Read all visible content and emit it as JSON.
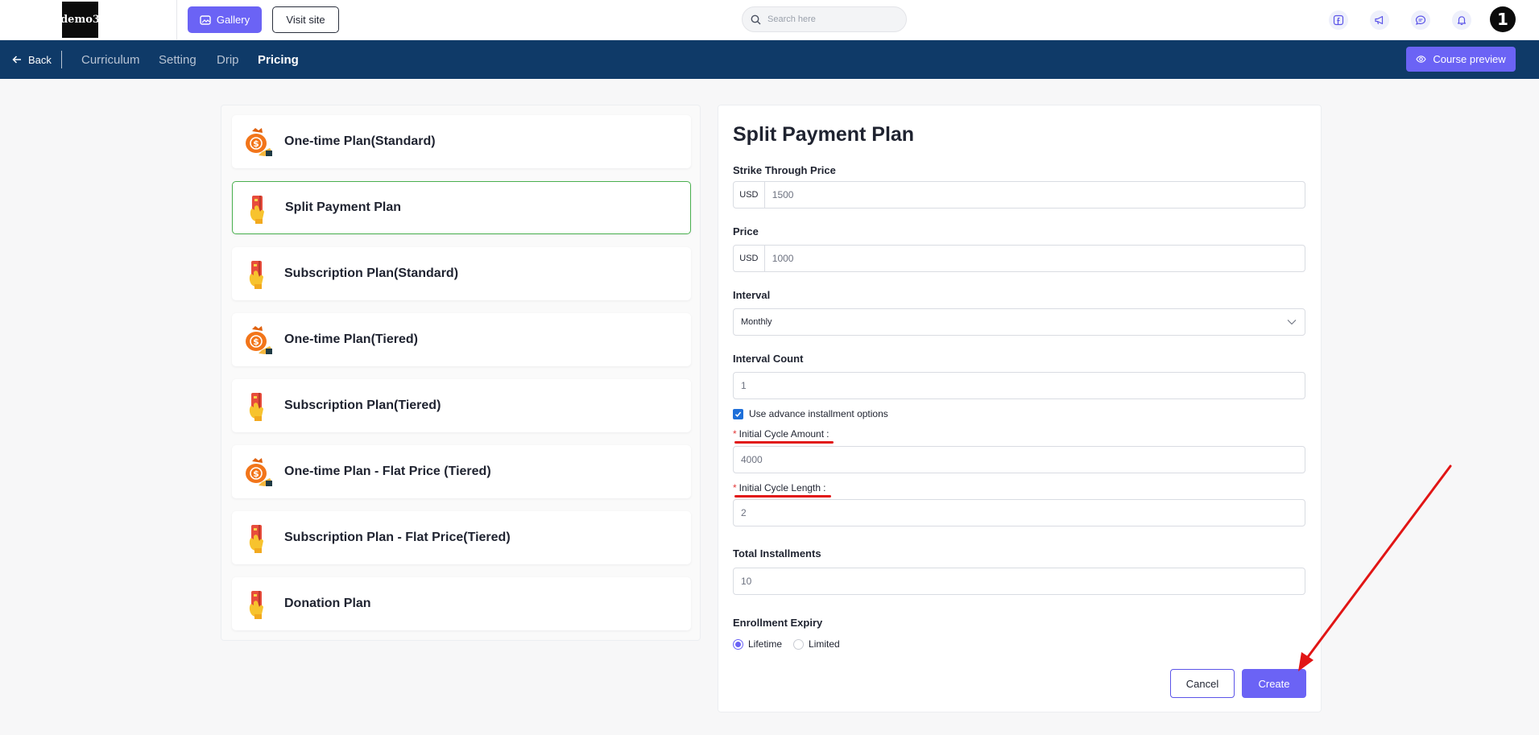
{
  "topbar": {
    "logo_text": "demo3",
    "gallery_label": "Gallery",
    "visit_site_label": "Visit site",
    "search_placeholder": "Search here",
    "avatar_text": "1",
    "icons": [
      "facebook-icon",
      "megaphone-icon",
      "chat-icon",
      "bell-icon"
    ]
  },
  "nav": {
    "back_label": "Back",
    "tabs": [
      {
        "label": "Curriculum",
        "active": false
      },
      {
        "label": "Setting",
        "active": false
      },
      {
        "label": "Drip",
        "active": false
      },
      {
        "label": "Pricing",
        "active": true
      }
    ],
    "course_preview_label": "Course preview"
  },
  "plans": [
    {
      "label": "One-time Plan(Standard)",
      "icon": "money-bag-icon",
      "selected": false
    },
    {
      "label": "Split Payment Plan",
      "icon": "card-hand-icon",
      "selected": true
    },
    {
      "label": "Subscription Plan(Standard)",
      "icon": "card-hand-icon",
      "selected": false
    },
    {
      "label": "One-time Plan(Tiered)",
      "icon": "money-bag-icon",
      "selected": false
    },
    {
      "label": "Subscription Plan(Tiered)",
      "icon": "card-hand-icon",
      "selected": false
    },
    {
      "label": "One-time Plan - Flat Price (Tiered)",
      "icon": "money-bag-icon",
      "selected": false
    },
    {
      "label": "Subscription Plan - Flat Price(Tiered)",
      "icon": "card-hand-icon",
      "selected": false
    },
    {
      "label": "Donation Plan",
      "icon": "card-hand-icon",
      "selected": false
    }
  ],
  "form": {
    "title": "Split Payment Plan",
    "strike_price": {
      "label": "Strike Through Price",
      "currency": "USD",
      "value": "1500"
    },
    "price": {
      "label": "Price",
      "currency": "USD",
      "value": "1000"
    },
    "interval": {
      "label": "Interval",
      "value": "Monthly"
    },
    "interval_count": {
      "label": "Interval Count",
      "value": "1"
    },
    "advance_installment": {
      "label": "Use advance installment options",
      "checked": true
    },
    "initial_cycle_amount": {
      "label": "Initial Cycle Amount",
      "value": "4000",
      "required_mark": "*",
      "suffix": ":"
    },
    "initial_cycle_length": {
      "label": "Initial Cycle Length",
      "value": "2",
      "required_mark": "*",
      "suffix": ":"
    },
    "total_installments": {
      "label": "Total Installments",
      "value": "10"
    },
    "enrollment_expiry": {
      "label": "Enrollment Expiry",
      "options": [
        {
          "label": "Lifetime",
          "selected": true
        },
        {
          "label": "Limited",
          "selected": false
        }
      ]
    },
    "cancel_label": "Cancel",
    "create_label": "Create"
  },
  "colors": {
    "accent": "#6b63f5",
    "nav_bg": "#0f3a68",
    "selected_border": "#49b04e",
    "annotation_red": "#e11515"
  }
}
